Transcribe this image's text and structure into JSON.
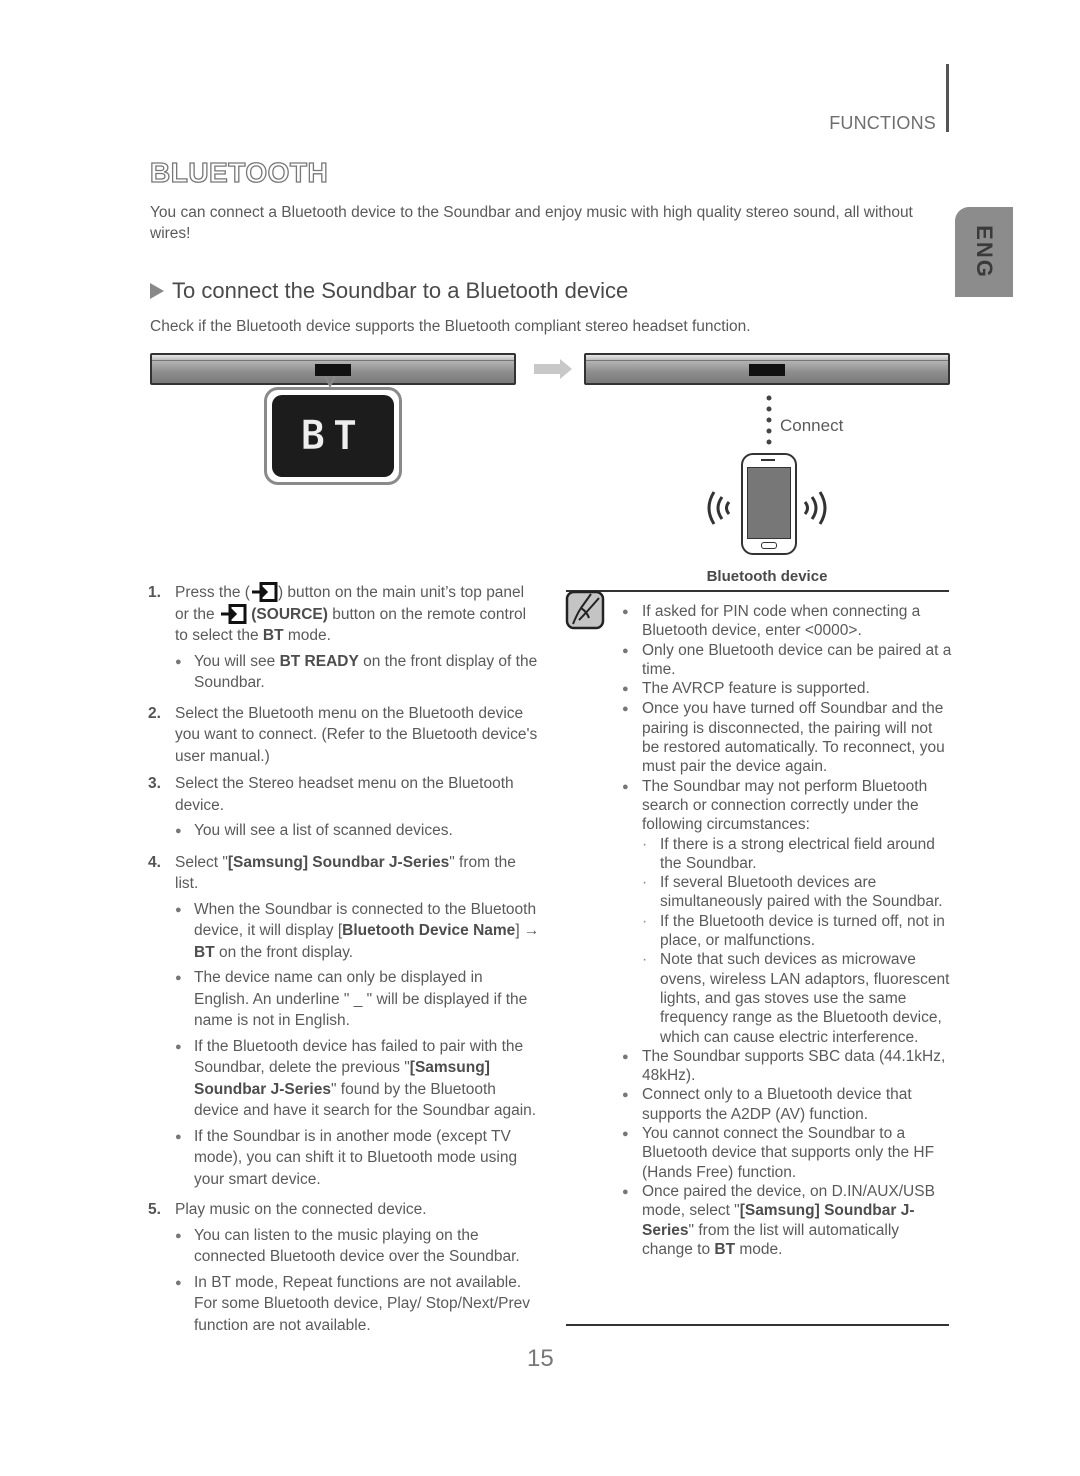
{
  "header": {
    "section": "FUNCTIONS",
    "language_tab": "ENG"
  },
  "title": "BLUETOOTH",
  "intro": "You can connect a Bluetooth device to the Soundbar and enjoy music with high quality stereo sound, all without wires!",
  "subheading": "To connect the Soundbar to a Bluetooth device",
  "check_note": "Check if the Bluetooth device supports the Bluetooth compliant stereo headset function.",
  "illustration": {
    "display_text": "BT",
    "connect_label": "Connect",
    "device_label": "Bluetooth device"
  },
  "steps": [
    {
      "num": "1.",
      "parts": [
        "Press the (",
        ") button on the main unit’s top panel or the ",
        "(SOURCE)",
        " button on the remote control to select the ",
        "BT",
        " mode."
      ],
      "bullets": [
        {
          "parts": [
            "You will see ",
            "BT READY",
            " on the front display of the Soundbar."
          ]
        }
      ]
    },
    {
      "num": "2.",
      "text": "Select the Bluetooth menu on the Bluetooth device you want to connect. (Refer to the Bluetooth device's user manual.)",
      "bullets": []
    },
    {
      "num": "3.",
      "text": "Select the Stereo headset menu on the Bluetooth device.",
      "bullets": [
        {
          "text": "You will see a list of scanned devices."
        }
      ]
    },
    {
      "num": "4.",
      "parts": [
        "Select \"",
        "[Samsung] Soundbar J-Series",
        "\" from the list."
      ],
      "bullets": [
        {
          "parts": [
            "When the Soundbar is connected to the Bluetooth device, it will display [",
            "Bluetooth Device Name",
            "] → ",
            "BT",
            " on the front display."
          ]
        },
        {
          "text": "The device name can only be displayed in English. An underline \" _ \" will be displayed if the name is not in English."
        },
        {
          "parts": [
            "If the Bluetooth device has failed to pair with the Soundbar, delete the previous \"",
            "[Samsung] Soundbar J-Series",
            "\" found by the Bluetooth device and have it search for the Soundbar again."
          ]
        },
        {
          "text": "If the Soundbar is in another mode (except TV mode), you can shift it to Bluetooth mode using your smart device."
        }
      ]
    },
    {
      "num": "5.",
      "text": "Play music on the connected device.",
      "bullets": [
        {
          "text": "You can listen to the music playing on the connected Bluetooth device over the Soundbar."
        },
        {
          "text": "In BT mode, Repeat functions are not available. For some Bluetooth device, Play/ Stop/Next/Prev function are not available."
        }
      ]
    }
  ],
  "notes": [
    {
      "text": "If asked for PIN code when connecting a Bluetooth device, enter <0000>."
    },
    {
      "text": "Only one Bluetooth device can be paired at a time."
    },
    {
      "text": "The AVRCP feature is supported."
    },
    {
      "text": "Once you have turned off Soundbar and the pairing is disconnected, the pairing will not be restored automatically. To reconnect, you must pair the device again."
    },
    {
      "text": "The Soundbar may not perform Bluetooth search or connection correctly under the following circumstances:",
      "sub": [
        "If there is a strong electrical field around the Soundbar.",
        "If several Bluetooth devices are simultaneously paired with the Soundbar.",
        "If the Bluetooth device is turned off, not in place, or malfunctions.",
        "Note that such devices as microwave ovens, wireless LAN adaptors, fluorescent lights, and gas stoves use the same frequency range as the Bluetooth device, which can cause electric interference."
      ]
    },
    {
      "text": "The Soundbar supports SBC data (44.1kHz, 48kHz)."
    },
    {
      "text": "Connect only to a Bluetooth device that supports the A2DP (AV) function."
    },
    {
      "text": "You cannot connect the Soundbar to a Bluetooth device that supports only the HF (Hands Free) function."
    },
    {
      "parts": [
        "Once paired the device, on D.IN/AUX/USB mode, select \"",
        "[Samsung] Soundbar J-Series",
        "\" from the list will automatically change to ",
        "BT",
        " mode."
      ]
    }
  ],
  "page_number": "15"
}
